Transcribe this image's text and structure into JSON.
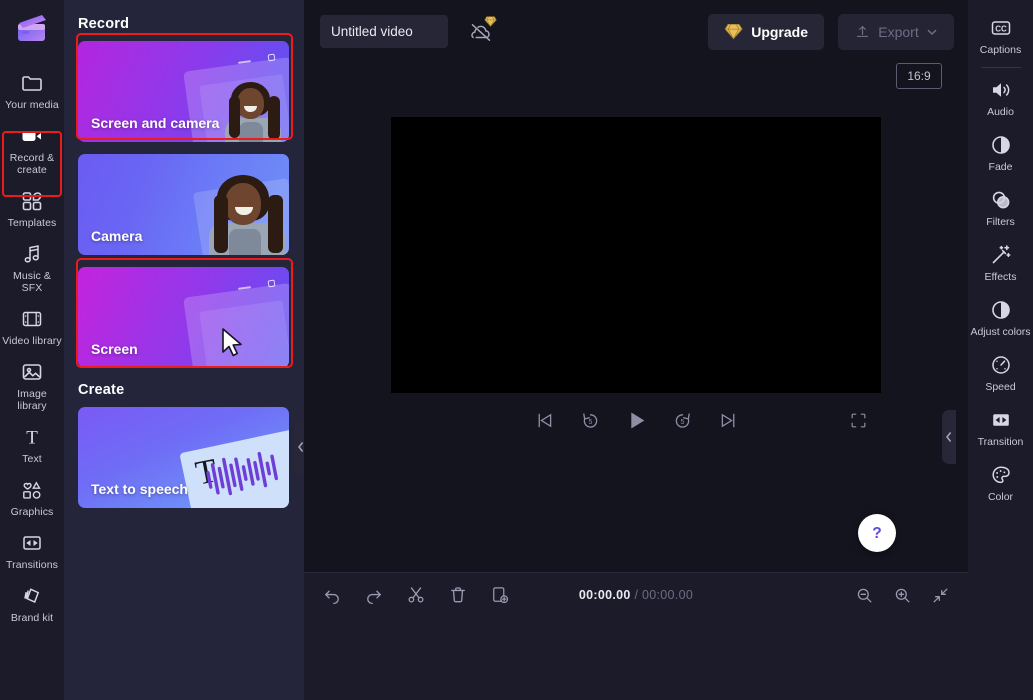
{
  "app": {
    "logo_name": "clipchamp-logo"
  },
  "left_rail": {
    "items": [
      {
        "label": "Your media",
        "icon": "folder-icon",
        "name": "your-media",
        "active": false
      },
      {
        "label": "Record & create",
        "icon": "video-camera-icon",
        "name": "record-create",
        "active": true
      },
      {
        "label": "Templates",
        "icon": "templates-icon",
        "name": "templates",
        "active": false
      },
      {
        "label": "Music & SFX",
        "icon": "music-note-icon",
        "name": "music-sfx",
        "active": false
      },
      {
        "label": "Video library",
        "icon": "film-strip-icon",
        "name": "video-library",
        "active": false
      },
      {
        "label": "Image library",
        "icon": "image-icon",
        "name": "image-library",
        "active": false
      },
      {
        "label": "Text",
        "icon": "text-icon",
        "name": "text",
        "active": false
      },
      {
        "label": "Graphics",
        "icon": "shapes-icon",
        "name": "graphics",
        "active": false
      },
      {
        "label": "Transitions",
        "icon": "transitions-icon",
        "name": "transitions",
        "active": false
      },
      {
        "label": "Brand kit",
        "icon": "brand-kit-icon",
        "name": "brand-kit",
        "active": false
      }
    ]
  },
  "panel": {
    "record_heading": "Record",
    "create_heading": "Create",
    "cards": [
      {
        "label": "Screen and camera",
        "name": "card-screen-and-camera",
        "highlighted": true
      },
      {
        "label": "Camera",
        "name": "card-camera",
        "highlighted": false
      },
      {
        "label": "Screen",
        "name": "card-screen",
        "highlighted": true
      },
      {
        "label": "Text to speech",
        "name": "card-text-to-speech",
        "highlighted": false
      }
    ],
    "collapse_icon": "chevron-left-icon"
  },
  "topbar": {
    "project_title": "Untitled video",
    "project_title_placeholder": "Untitled video",
    "autosave_icon": "cloud-off-icon",
    "autosave_badge_icon": "diamond-icon",
    "upgrade_label": "Upgrade",
    "upgrade_icon": "diamond-icon",
    "export_label": "Export",
    "export_icon": "upload-icon",
    "export_chevron_icon": "chevron-down-icon"
  },
  "preview": {
    "aspect_ratio": "16:9",
    "controls": [
      {
        "name": "skip-to-start-button",
        "icon": "skip-start-icon"
      },
      {
        "name": "rewind-5s-button",
        "icon": "rewind-5-icon",
        "seconds": "5"
      },
      {
        "name": "play-button",
        "icon": "play-icon"
      },
      {
        "name": "forward-5s-button",
        "icon": "forward-5-icon",
        "seconds": "5"
      },
      {
        "name": "skip-to-end-button",
        "icon": "skip-end-icon"
      }
    ],
    "fullscreen_icon": "fullscreen-icon",
    "collapse_icon": "chevron-left-icon",
    "help_icon": "question-mark-icon"
  },
  "timeline": {
    "tools": [
      {
        "name": "undo-button",
        "icon": "undo-icon"
      },
      {
        "name": "redo-button",
        "icon": "redo-icon"
      },
      {
        "name": "split-button",
        "icon": "scissors-icon"
      },
      {
        "name": "delete-button",
        "icon": "trash-icon"
      },
      {
        "name": "duplicate-button",
        "icon": "duplicate-icon"
      }
    ],
    "current_time": "00:00.00",
    "separator": "/",
    "total_time": "00:00.00",
    "zoom_tools": [
      {
        "name": "zoom-out-button",
        "icon": "magnifier-minus-icon"
      },
      {
        "name": "zoom-in-button",
        "icon": "magnifier-plus-icon"
      },
      {
        "name": "zoom-to-fit-button",
        "icon": "fit-arrows-icon"
      }
    ]
  },
  "right_rail": {
    "items": [
      {
        "label": "Captions",
        "icon": "closed-captions-icon",
        "name": "captions",
        "separator_after": true
      },
      {
        "label": "Audio",
        "icon": "speaker-icon",
        "name": "audio",
        "separator_after": false
      },
      {
        "label": "Fade",
        "icon": "fade-circle-icon",
        "name": "fade",
        "separator_after": false
      },
      {
        "label": "Filters",
        "icon": "filters-circles-icon",
        "name": "filters",
        "separator_after": false
      },
      {
        "label": "Effects",
        "icon": "magic-wand-icon",
        "name": "effects",
        "separator_after": false
      },
      {
        "label": "Adjust colors",
        "icon": "half-circle-icon",
        "name": "adjust-colors",
        "separator_after": false
      },
      {
        "label": "Speed",
        "icon": "speedometer-icon",
        "name": "speed",
        "separator_after": false
      },
      {
        "label": "Transition",
        "icon": "transition-icon",
        "name": "transition",
        "separator_after": false
      },
      {
        "label": "Color",
        "icon": "palette-icon",
        "name": "color",
        "separator_after": false
      }
    ]
  },
  "colors": {
    "highlight": "#ee1b1b",
    "panel_bg": "#24243a",
    "rail_bg": "#1b1b29",
    "stage_bg": "#14141f",
    "accent_gold": "#e8bf5c",
    "text": "#e6e6ef",
    "muted": "#6d6d84"
  }
}
